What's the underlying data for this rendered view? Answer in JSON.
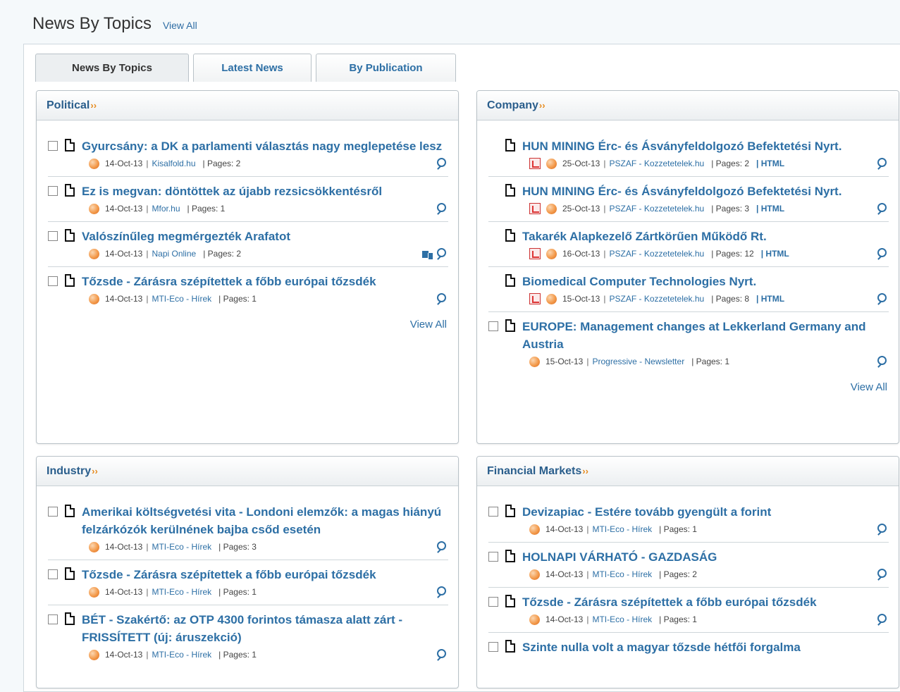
{
  "header": {
    "title": "News By Topics",
    "view_all": "View All"
  },
  "tabs": [
    {
      "label": "News By Topics",
      "active": true
    },
    {
      "label": "Latest News",
      "active": false
    },
    {
      "label": "By Publication",
      "active": false
    }
  ],
  "icons": {
    "arrow": "double-chevron-right-icon",
    "document": "document-icon",
    "pdf": "pdf-icon",
    "globe": "globe-icon",
    "preview": "magnify-preview-icon",
    "translate": "translate-icon"
  },
  "colors": {
    "link": "#2d6fa5",
    "accent": "#e68a1c"
  },
  "panels": {
    "political": {
      "title": "Political",
      "arrow": "››",
      "view_all": "View All",
      "items": [
        {
          "headline": "Gyurcsány: a DK a parlamenti választás nagy meglepetése lesz",
          "date": "14-Oct-13",
          "sep": "|",
          "publication": "Kisalfold.hu",
          "pages": "| Pages: 2"
        },
        {
          "headline": "Ez is megvan: döntöttek az újabb rezsicsökkentésről",
          "date": "14-Oct-13",
          "sep": "|",
          "publication": "Mfor.hu",
          "pages": "| Pages: 1"
        },
        {
          "headline": "Valószínűleg megmérgezték Arafatot",
          "date": "14-Oct-13",
          "sep": "|",
          "publication": "Napi Online",
          "pages": "| Pages: 2"
        },
        {
          "headline": "Tőzsde - Zárásra szépítettek a főbb európai tőzsdék",
          "date": "14-Oct-13",
          "sep": "|",
          "publication": "MTI-Eco - Hírek",
          "pages": "| Pages: 1"
        }
      ]
    },
    "company": {
      "title": "Company",
      "arrow": "››",
      "view_all": "View All",
      "items": [
        {
          "headline": "HUN MINING Érc- és Ásványfeldolgozó Befektetési Nyrt.",
          "date": "25-Oct-13",
          "sep": "|",
          "publication": "PSZAF - Kozzetetelek.hu",
          "pages": "| Pages: 2",
          "html": "| HTML"
        },
        {
          "headline": "HUN MINING Érc- és Ásványfeldolgozó Befektetési Nyrt.",
          "date": "25-Oct-13",
          "sep": "|",
          "publication": "PSZAF - Kozzetetelek.hu",
          "pages": "| Pages: 3",
          "html": "| HTML"
        },
        {
          "headline": "Takarék Alapkezelő Zártkörűen Működő Rt.",
          "date": "16-Oct-13",
          "sep": "|",
          "publication": "PSZAF - Kozzetetelek.hu",
          "pages": "| Pages: 12",
          "html": "| HTML"
        },
        {
          "headline": "Biomedical Computer Technologies Nyrt.",
          "date": "15-Oct-13",
          "sep": "|",
          "publication": "PSZAF - Kozzetetelek.hu",
          "pages": "| Pages: 8",
          "html": "| HTML"
        },
        {
          "headline": "EUROPE: Management changes at Lekkerland Germany and Austria",
          "date": "15-Oct-13",
          "sep": "|",
          "publication": "Progressive - Newsletter",
          "pages": "| Pages: 1"
        }
      ]
    },
    "industry": {
      "title": "Industry",
      "arrow": "››",
      "items": [
        {
          "headline": "Amerikai költségvetési vita - Londoni elemzők: a magas hiányú felzárkózók kerülnének bajba csőd esetén",
          "date": "14-Oct-13",
          "sep": "|",
          "publication": "MTI-Eco - Hírek",
          "pages": "| Pages: 3"
        },
        {
          "headline": "Tőzsde - Zárásra szépítettek a főbb európai tőzsdék",
          "date": "14-Oct-13",
          "sep": "|",
          "publication": "MTI-Eco - Hírek",
          "pages": "| Pages: 1"
        },
        {
          "headline": "BÉT - Szakértő: az OTP 4300 forintos támasza alatt zárt - FRISSÍTETT (új: áruszekció)",
          "date": "14-Oct-13",
          "sep": "|",
          "publication": "MTI-Eco - Hírek",
          "pages": "| Pages: 1"
        }
      ]
    },
    "financial": {
      "title": "Financial Markets",
      "arrow": "››",
      "items": [
        {
          "headline": "Devizapiac - Estére tovább gyengült a forint",
          "date": "14-Oct-13",
          "sep": "|",
          "publication": "MTI-Eco - Hírek",
          "pages": "| Pages: 1"
        },
        {
          "headline": "HOLNAPI VÁRHATÓ - GAZDASÁG",
          "date": "14-Oct-13",
          "sep": "|",
          "publication": "MTI-Eco - Hírek",
          "pages": "| Pages: 2"
        },
        {
          "headline": "Tőzsde - Zárásra szépítettek a főbb európai tőzsdék",
          "date": "14-Oct-13",
          "sep": "|",
          "publication": "MTI-Eco - Hírek",
          "pages": "| Pages: 1"
        },
        {
          "headline": "Szinte nulla volt a magyar tőzsde hétfői forgalma"
        }
      ]
    }
  }
}
